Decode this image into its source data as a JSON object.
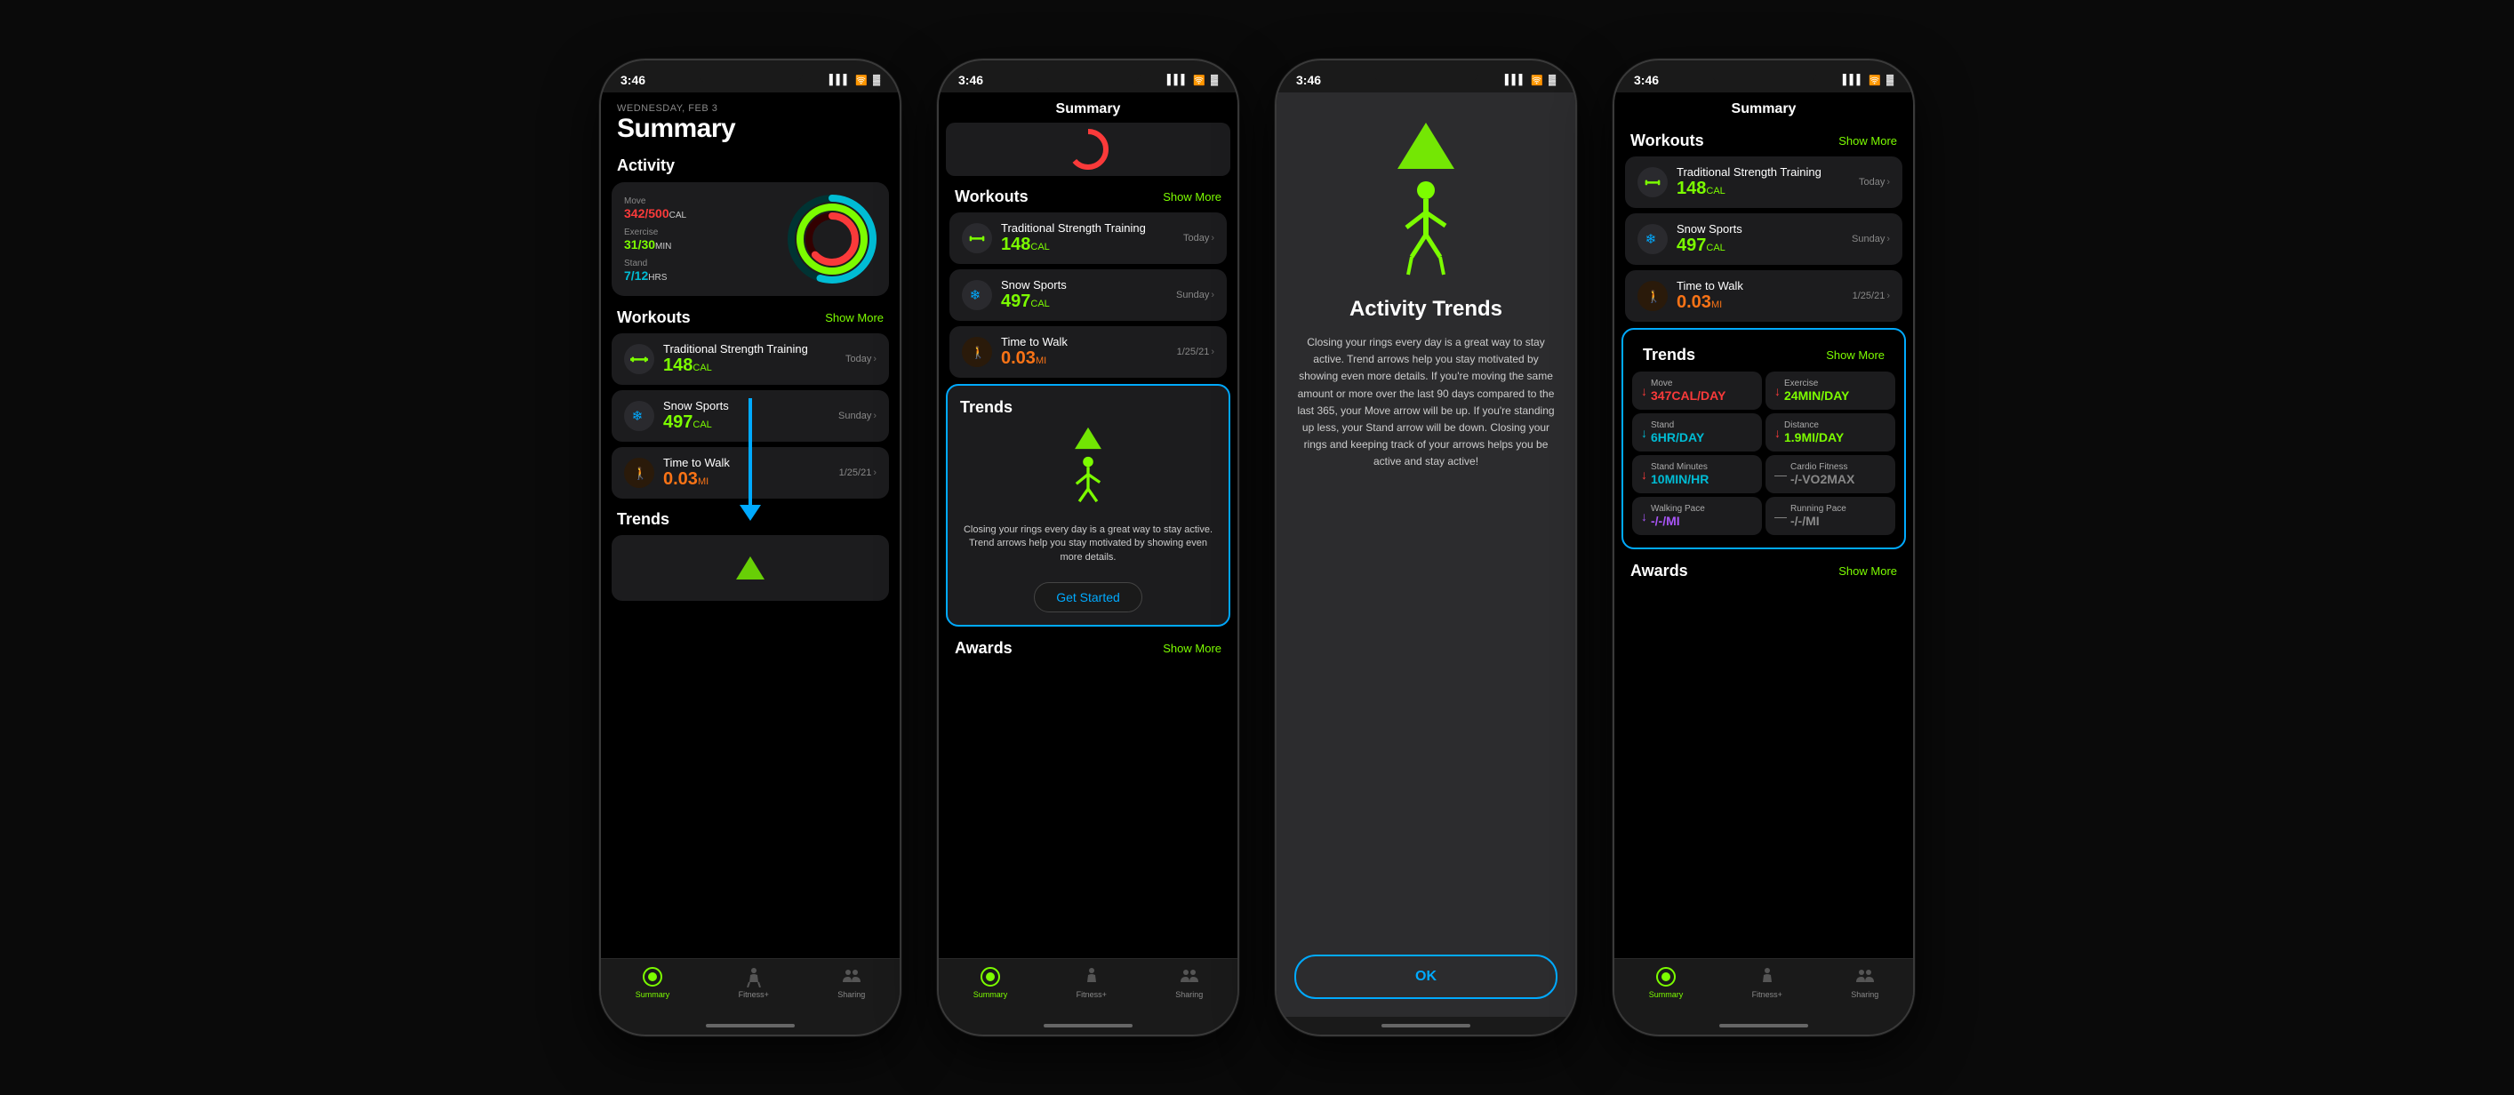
{
  "phones": [
    {
      "id": "phone1",
      "status_time": "3:46",
      "screen": {
        "date": "WEDNESDAY, FEB 3",
        "title": "Summary",
        "activity_section": "Activity",
        "move_label": "Move",
        "move_value": "342/500",
        "move_unit": "CAL",
        "exercise_label": "Exercise",
        "exercise_value": "31/30",
        "exercise_unit": "MIN",
        "stand_label": "Stand",
        "stand_value": "7/12",
        "stand_unit": "HRS",
        "workouts_title": "Workouts",
        "show_more": "Show More",
        "workouts": [
          {
            "name": "Traditional Strength Training",
            "cal": "148",
            "unit": "CAL",
            "meta": "Today",
            "icon": "strength"
          },
          {
            "name": "Snow Sports",
            "cal": "497",
            "unit": "CAL",
            "meta": "Sunday",
            "icon": "snow"
          },
          {
            "name": "Time to Walk",
            "cal": "0.03",
            "unit": "MI",
            "meta": "1/25/21",
            "icon": "walk"
          }
        ],
        "trends_title": "Trends"
      }
    },
    {
      "id": "phone2",
      "status_time": "3:46",
      "screen": {
        "title": "Summary",
        "workouts_title": "Workouts",
        "show_more": "Show More",
        "workouts": [
          {
            "name": "Traditional Strength Training",
            "cal": "148",
            "unit": "CAL",
            "meta": "Today",
            "icon": "strength"
          },
          {
            "name": "Snow Sports",
            "cal": "497",
            "unit": "CAL",
            "meta": "Sunday",
            "icon": "snow"
          },
          {
            "name": "Time to Walk",
            "cal": "0.03",
            "unit": "MI",
            "meta": "1/25/21",
            "icon": "walk"
          }
        ],
        "trends_title": "Trends",
        "trends_desc": "Closing your rings every day is a great way to stay active. Trend arrows help you stay motivated by showing even more details.",
        "get_started": "Get Started",
        "awards_title": "Awards",
        "awards_show_more": "Show More"
      }
    },
    {
      "id": "phone3",
      "status_time": "3:46",
      "screen": {
        "modal_title": "Activity Trends",
        "modal_desc": "Closing your rings every day is a great way to stay active. Trend arrows help you stay motivated by showing even more details. If you're moving the same amount or more over the last 90 days compared to the last 365, your Move arrow will be up. If you're standing up less, your Stand arrow will be down. Closing your rings and keeping track of your arrows helps you be active and stay active!",
        "ok_button": "OK"
      }
    },
    {
      "id": "phone4",
      "status_time": "3:46",
      "screen": {
        "title": "Summary",
        "workouts_title": "Workouts",
        "show_more": "Show More",
        "workouts": [
          {
            "name": "Traditional Strength Training",
            "cal": "148",
            "unit": "CAL",
            "meta": "Today",
            "icon": "strength"
          },
          {
            "name": "Snow Sports",
            "cal": "497",
            "unit": "CAL",
            "meta": "Sunday",
            "icon": "snow"
          },
          {
            "name": "Time to Walk",
            "cal": "0.03",
            "unit": "MI",
            "meta": "1/25/21",
            "icon": "walk"
          }
        ],
        "trends_title": "Trends",
        "trends_show_more": "Show More",
        "trend_items": [
          {
            "label": "Move",
            "value": "347CAL/DAY",
            "arrow": "down",
            "color": "move"
          },
          {
            "label": "Exercise",
            "value": "24MIN/DAY",
            "arrow": "down",
            "color": "exercise"
          },
          {
            "label": "Stand",
            "value": "6HR/DAY",
            "arrow": "teal",
            "color": "stand"
          },
          {
            "label": "Distance",
            "value": "1.9MI/DAY",
            "arrow": "down",
            "color": "distance"
          },
          {
            "label": "Stand Minutes",
            "value": "10MIN/HR",
            "arrow": "down",
            "color": "stand"
          },
          {
            "label": "Cardio Fitness",
            "value": "-/-VO2MAX",
            "arrow": "dash",
            "color": "cardio"
          },
          {
            "label": "Walking Pace",
            "value": "-/-/MI",
            "arrow": "dash",
            "color": "purple"
          },
          {
            "label": "Running Pace",
            "value": "-/-/MI",
            "arrow": "dash",
            "color": "orange"
          }
        ],
        "awards_title": "Awards",
        "awards_show_more": "Show More"
      }
    }
  ],
  "tabs": [
    {
      "label": "Summary",
      "active": true,
      "icon": "summary-circle"
    },
    {
      "label": "Fitness+",
      "active": false,
      "icon": "fitness-person"
    },
    {
      "label": "Sharing",
      "active": false,
      "icon": "sharing-people"
    }
  ]
}
